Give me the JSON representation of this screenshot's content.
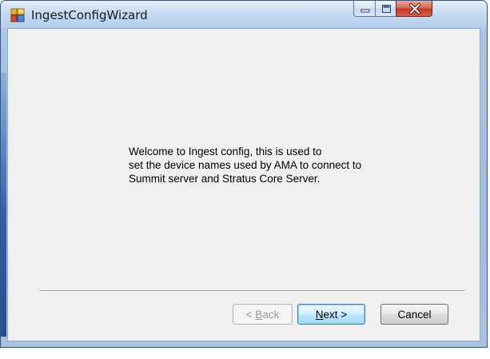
{
  "window": {
    "title": "IngestConfigWizard",
    "app_icon": "app-icon",
    "controls": {
      "minimize_icon": "minimize-icon",
      "maximize_icon": "maximize-icon",
      "close_icon": "close-icon"
    }
  },
  "content": {
    "welcome_lines": [
      "Welcome to Ingest config, this is used to",
      "set the device names used by AMA to connect to",
      "Summit server and Stratus Core Server."
    ]
  },
  "buttons": {
    "back": {
      "label_prefix": "< ",
      "label_mnemonic": "B",
      "label_suffix": "ack",
      "enabled": false
    },
    "next": {
      "label_mnemonic": "N",
      "label_suffix": "ext >",
      "enabled": true
    },
    "cancel": {
      "label": "Cancel",
      "enabled": true
    }
  },
  "colors": {
    "accent_border": "#3c7fb1",
    "close_red": "#c23a22",
    "client_bg": "#f0f0f0"
  }
}
